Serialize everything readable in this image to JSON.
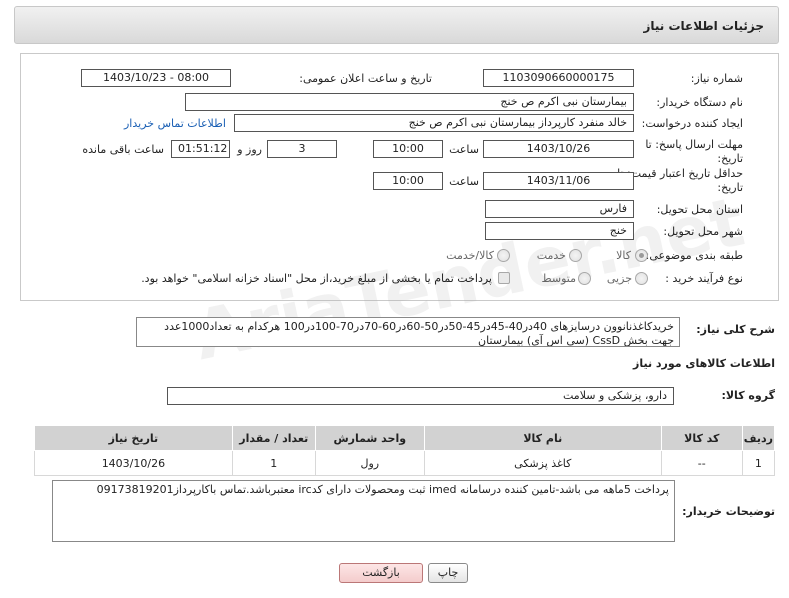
{
  "header": {
    "title": "جزئیات اطلاعات نیاز"
  },
  "form": {
    "need_number": {
      "label": "شماره نیاز:",
      "value": "1103090660000175"
    },
    "announce": {
      "label": "تاریخ و ساعت اعلان عمومی:",
      "value": "1403/10/23 - 08:00"
    },
    "buyer_org": {
      "label": "نام دستگاه خریدار:",
      "value": "بیمارستان نبی اکرم  ص  خنج"
    },
    "creator": {
      "label": "ایجاد کننده درخواست:",
      "value": "خالد منفرد کارپرداز بیمارستان نبی اکرم  ص  خنج",
      "contact_link": "اطلاعات تماس خریدار"
    },
    "reply_deadline": {
      "label_line1": "مهلت ارسال پاسخ: تا",
      "label_line2": "تاریخ:",
      "date": "1403/10/26",
      "time_label": "ساعت",
      "time": "10:00",
      "days": "3",
      "days_label": "روز و",
      "remaining": "01:51:12",
      "remaining_label": "ساعت باقی مانده"
    },
    "price_validity": {
      "label_line1": "حداقل تاریخ اعتبار قیمت: تا",
      "label_line2": "تاریخ:",
      "date": "1403/11/06",
      "time_label": "ساعت",
      "time": "10:00"
    },
    "province": {
      "label": "استان محل تحویل:",
      "value": "فارس"
    },
    "city": {
      "label": "شهر محل تحویل:",
      "value": "خنج"
    },
    "category": {
      "label": "طبقه بندی موضوعی:",
      "options": [
        "کالا",
        "خدمت",
        "کالا/خدمت"
      ],
      "selected": "کالا"
    },
    "process": {
      "label": "نوع فرآیند خرید :",
      "options": [
        "جزیی",
        "متوسط"
      ],
      "payment_text": "پرداخت تمام یا بخشی از مبلغ خرید،از محل \"اسناد خزانه اسلامی\" خواهد بود."
    }
  },
  "description": {
    "label": "شرح کلی نیاز:",
    "text": "خریدکاغذنانوون درسایزهای 40در40-45در45-50در50-60در60-70در70-100در100 هرکدام به تعداد1000عدد جهت بخش CssD  (سی اس آی) بیمارستان"
  },
  "goods_section": {
    "title": "اطلاعات کالاهای مورد نیاز",
    "group_label": "گروه کالا:",
    "group_value": "دارو، پزشکی و سلامت"
  },
  "table": {
    "headers": [
      "ردیف",
      "کد کالا",
      "نام کالا",
      "واحد شمارش",
      "تعداد / مقدار",
      "تاریخ نیاز"
    ],
    "rows": [
      [
        "1",
        "--",
        "کاغذ پزشکی",
        "رول",
        "1",
        "1403/10/26"
      ]
    ]
  },
  "buyer_notes": {
    "label": "توضیحات خریدار:",
    "text": "پرداخت 5ماهه می باشد-تامین کننده درسامانه imed ثبت ومحصولات دارای کدirc معتبرباشد.تماس باکارپرداز09173819201"
  },
  "buttons": {
    "print": "چاپ",
    "back": "بازگشت"
  },
  "watermark": "AriaTender.net"
}
